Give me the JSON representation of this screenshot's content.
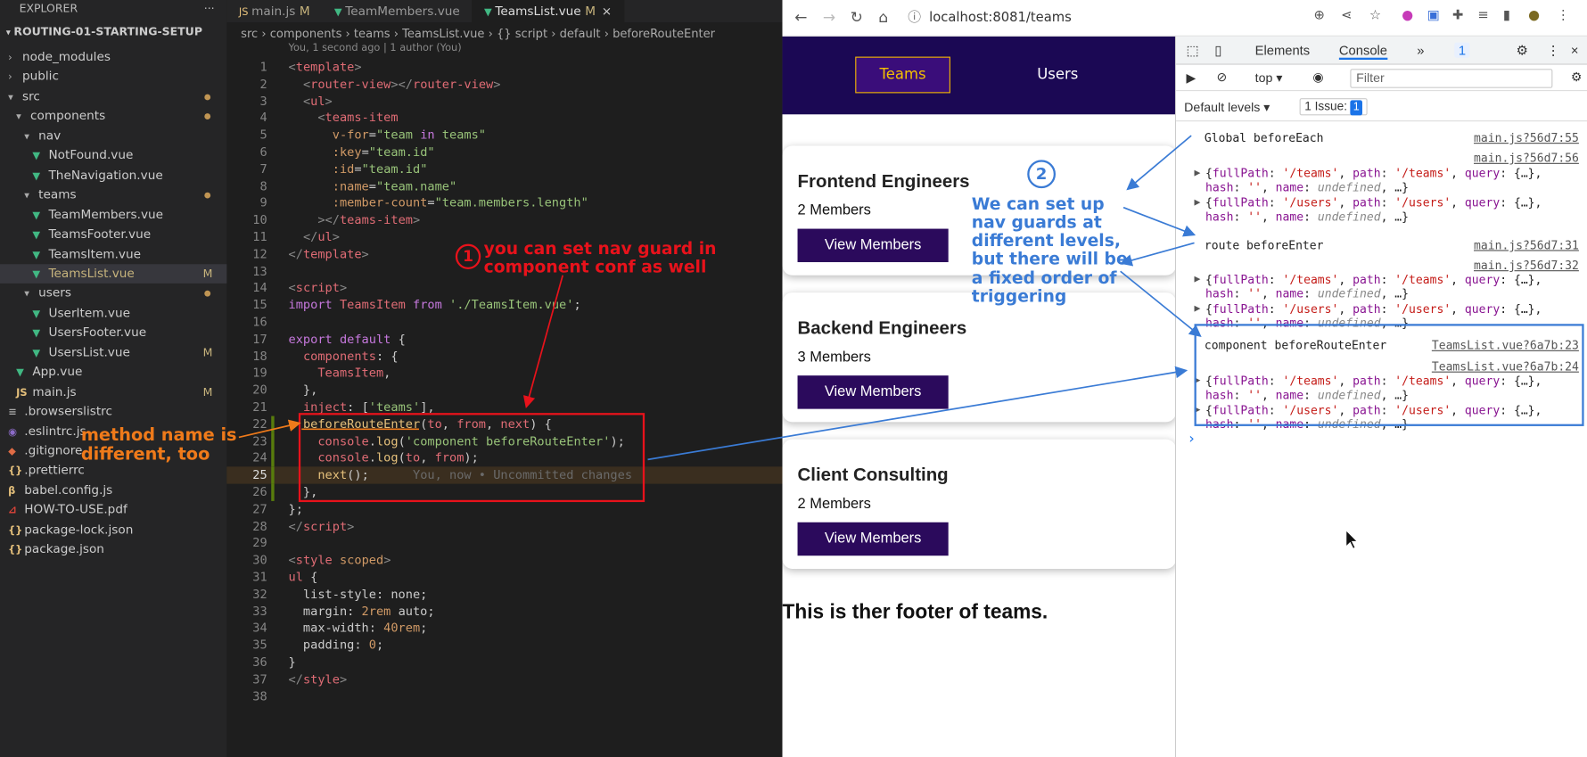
{
  "explorer": {
    "title": "EXPLORER",
    "more": "···",
    "project": "ROUTING-01-STARTING-SETUP",
    "items": [
      {
        "label": "node_modules",
        "kind": "folder",
        "open": false,
        "depth": 1,
        "icon": "chevron-right-icon"
      },
      {
        "label": "public",
        "kind": "folder",
        "open": false,
        "depth": 1,
        "icon": "chevron-right-icon"
      },
      {
        "label": "src",
        "kind": "folder",
        "open": true,
        "depth": 1,
        "dot": true,
        "icon": "chevron-down-icon"
      },
      {
        "label": "components",
        "kind": "folder",
        "open": true,
        "depth": 2,
        "dot": true,
        "icon": "chevron-down-icon"
      },
      {
        "label": "nav",
        "kind": "folder",
        "open": true,
        "depth": 3,
        "icon": "chevron-down-icon"
      },
      {
        "label": "NotFound.vue",
        "kind": "vue",
        "depth": 4,
        "icon": "vue-icon"
      },
      {
        "label": "TheNavigation.vue",
        "kind": "vue",
        "depth": 4,
        "icon": "vue-icon"
      },
      {
        "label": "teams",
        "kind": "folder",
        "open": true,
        "depth": 3,
        "dot": true,
        "icon": "chevron-down-icon"
      },
      {
        "label": "TeamMembers.vue",
        "kind": "vue",
        "depth": 4,
        "icon": "vue-icon"
      },
      {
        "label": "TeamsFooter.vue",
        "kind": "vue",
        "depth": 4,
        "icon": "vue-icon"
      },
      {
        "label": "TeamsItem.vue",
        "kind": "vue",
        "depth": 4,
        "icon": "vue-icon"
      },
      {
        "label": "TeamsList.vue",
        "kind": "vue",
        "depth": 4,
        "selected": true,
        "badge": "M",
        "icon": "vue-icon"
      },
      {
        "label": "users",
        "kind": "folder",
        "open": true,
        "depth": 3,
        "dot": true,
        "icon": "chevron-down-icon"
      },
      {
        "label": "UserItem.vue",
        "kind": "vue",
        "depth": 4,
        "icon": "vue-icon"
      },
      {
        "label": "UsersFooter.vue",
        "kind": "vue",
        "depth": 4,
        "icon": "vue-icon"
      },
      {
        "label": "UsersList.vue",
        "kind": "vue",
        "depth": 4,
        "badge": "M",
        "icon": "vue-icon"
      },
      {
        "label": "App.vue",
        "kind": "vue",
        "depth": 2,
        "icon": "vue-icon"
      },
      {
        "label": "main.js",
        "kind": "js",
        "depth": 2,
        "badge": "M",
        "icon": "js-icon"
      },
      {
        "label": ".browserslistrc",
        "kind": "config",
        "depth": 1,
        "icon": "list-icon"
      },
      {
        "label": ".eslintrc.js",
        "kind": "eslint",
        "depth": 1,
        "icon": "eslint-icon"
      },
      {
        "label": ".gitignore",
        "kind": "git",
        "depth": 1,
        "icon": "git-icon"
      },
      {
        "label": ".prettierrc",
        "kind": "json",
        "depth": 1,
        "icon": "braces-icon"
      },
      {
        "label": "babel.config.js",
        "kind": "babel",
        "depth": 1,
        "icon": "babel-icon"
      },
      {
        "label": "HOW-TO-USE.pdf",
        "kind": "pdf",
        "depth": 1,
        "icon": "pdf-icon"
      },
      {
        "label": "package-lock.json",
        "kind": "json",
        "depth": 1,
        "icon": "braces-icon"
      },
      {
        "label": "package.json",
        "kind": "json",
        "depth": 1,
        "icon": "braces-icon"
      }
    ]
  },
  "tabs": [
    {
      "label": "main.js",
      "icon": "js-icon",
      "mod": "M",
      "active": false
    },
    {
      "label": "TeamMembers.vue",
      "icon": "vue-icon",
      "mod": "",
      "active": false
    },
    {
      "label": "TeamsList.vue",
      "icon": "vue-icon",
      "mod": "M",
      "active": true,
      "close": "×"
    }
  ],
  "breadcrumb": "src › components › teams › TeamsList.vue › {} script › default › beforeRouteEnter",
  "blame": "You, 1 second ago | 1 author (You)",
  "code": [
    {
      "n": "1",
      "toks": [
        [
          "t-br",
          "<"
        ],
        [
          "t-tag",
          "template"
        ],
        [
          "t-br",
          ">"
        ]
      ]
    },
    {
      "n": "2",
      "toks": [
        [
          "t-pl",
          "  "
        ],
        [
          "t-br",
          "<"
        ],
        [
          "t-tag",
          "router-view"
        ],
        [
          "t-br",
          "></"
        ],
        [
          "t-tag",
          "router-view"
        ],
        [
          "t-br",
          ">"
        ]
      ]
    },
    {
      "n": "3",
      "toks": [
        [
          "t-pl",
          "  "
        ],
        [
          "t-br",
          "<"
        ],
        [
          "t-tag",
          "ul"
        ],
        [
          "t-br",
          ">"
        ]
      ]
    },
    {
      "n": "4",
      "toks": [
        [
          "t-pl",
          "    "
        ],
        [
          "t-br",
          "<"
        ],
        [
          "t-tag",
          "teams-item"
        ]
      ]
    },
    {
      "n": "5",
      "toks": [
        [
          "t-pl",
          "      "
        ],
        [
          "t-at",
          "v-for"
        ],
        [
          "t-pl",
          "="
        ],
        [
          "t-str",
          "\"team "
        ],
        [
          "t-kw",
          "in"
        ],
        [
          "t-str",
          " teams\""
        ]
      ]
    },
    {
      "n": "6",
      "toks": [
        [
          "t-pl",
          "      "
        ],
        [
          "t-at",
          ":key"
        ],
        [
          "t-pl",
          "="
        ],
        [
          "t-str",
          "\"team.id\""
        ]
      ]
    },
    {
      "n": "7",
      "toks": [
        [
          "t-pl",
          "      "
        ],
        [
          "t-at",
          ":id"
        ],
        [
          "t-pl",
          "="
        ],
        [
          "t-str",
          "\"team.id\""
        ]
      ]
    },
    {
      "n": "8",
      "toks": [
        [
          "t-pl",
          "      "
        ],
        [
          "t-at",
          ":name"
        ],
        [
          "t-pl",
          "="
        ],
        [
          "t-str",
          "\"team.name\""
        ]
      ]
    },
    {
      "n": "9",
      "toks": [
        [
          "t-pl",
          "      "
        ],
        [
          "t-at",
          ":member-count"
        ],
        [
          "t-pl",
          "="
        ],
        [
          "t-str",
          "\"team.members.length\""
        ]
      ]
    },
    {
      "n": "10",
      "toks": [
        [
          "t-pl",
          "    "
        ],
        [
          "t-br",
          "></"
        ],
        [
          "t-tag",
          "teams-item"
        ],
        [
          "t-br",
          ">"
        ]
      ]
    },
    {
      "n": "11",
      "toks": [
        [
          "t-pl",
          "  "
        ],
        [
          "t-br",
          "</"
        ],
        [
          "t-tag",
          "ul"
        ],
        [
          "t-br",
          ">"
        ]
      ]
    },
    {
      "n": "12",
      "toks": [
        [
          "t-br",
          "</"
        ],
        [
          "t-tag",
          "template"
        ],
        [
          "t-br",
          ">"
        ]
      ]
    },
    {
      "n": "13",
      "toks": []
    },
    {
      "n": "14",
      "toks": [
        [
          "t-br",
          "<"
        ],
        [
          "t-tag",
          "script"
        ],
        [
          "t-br",
          ">"
        ]
      ]
    },
    {
      "n": "15",
      "toks": [
        [
          "t-kw",
          "import"
        ],
        [
          "t-pl",
          " "
        ],
        [
          "t-var",
          "TeamsItem"
        ],
        [
          "t-pl",
          " "
        ],
        [
          "t-kw",
          "from"
        ],
        [
          "t-pl",
          " "
        ],
        [
          "t-str",
          "'./TeamsItem.vue'"
        ],
        [
          "t-pl",
          ";"
        ]
      ]
    },
    {
      "n": "16",
      "toks": []
    },
    {
      "n": "17",
      "toks": [
        [
          "t-kw",
          "export default"
        ],
        [
          "t-pl",
          " {"
        ]
      ]
    },
    {
      "n": "18",
      "toks": [
        [
          "t-pl",
          "  "
        ],
        [
          "t-var",
          "components"
        ],
        [
          "t-pl",
          ": {"
        ]
      ]
    },
    {
      "n": "19",
      "toks": [
        [
          "t-pl",
          "    "
        ],
        [
          "t-var",
          "TeamsItem"
        ],
        [
          "t-pl",
          ","
        ]
      ]
    },
    {
      "n": "20",
      "toks": [
        [
          "t-pl",
          "  },"
        ]
      ]
    },
    {
      "n": "21",
      "toks": [
        [
          "t-pl",
          "  "
        ],
        [
          "t-var",
          "inject"
        ],
        [
          "t-pl",
          ": ["
        ],
        [
          "t-str",
          "'teams'"
        ],
        [
          "t-pl",
          "],"
        ]
      ]
    },
    {
      "n": "22",
      "toks": [
        [
          "t-pl",
          "  "
        ],
        [
          "t-fn",
          "beforeRouteEnter"
        ],
        [
          "t-pl",
          "("
        ],
        [
          "t-var",
          "to"
        ],
        [
          "t-pl",
          ", "
        ],
        [
          "t-var",
          "from"
        ],
        [
          "t-pl",
          ", "
        ],
        [
          "t-var",
          "next"
        ],
        [
          "t-pl",
          ") {"
        ]
      ]
    },
    {
      "n": "23",
      "toks": [
        [
          "t-pl",
          "    "
        ],
        [
          "t-var",
          "console"
        ],
        [
          "t-pl",
          "."
        ],
        [
          "t-fn",
          "log"
        ],
        [
          "t-pl",
          "("
        ],
        [
          "t-str",
          "'component beforeRouteEnter'"
        ],
        [
          "t-pl",
          ");"
        ]
      ]
    },
    {
      "n": "24",
      "toks": [
        [
          "t-pl",
          "    "
        ],
        [
          "t-var",
          "console"
        ],
        [
          "t-pl",
          "."
        ],
        [
          "t-fn",
          "log"
        ],
        [
          "t-pl",
          "("
        ],
        [
          "t-var",
          "to"
        ],
        [
          "t-pl",
          ", "
        ],
        [
          "t-var",
          "from"
        ],
        [
          "t-pl",
          ");"
        ]
      ]
    },
    {
      "n": "25",
      "toks": [
        [
          "t-pl",
          "    "
        ],
        [
          "t-fn",
          "next"
        ],
        [
          "t-pl",
          "();"
        ],
        [
          "t-ghost",
          "      You, now • Uncommitted changes"
        ]
      ],
      "hl": true
    },
    {
      "n": "26",
      "toks": [
        [
          "t-pl",
          "  },"
        ]
      ]
    },
    {
      "n": "27",
      "toks": [
        [
          "t-pl",
          "};"
        ]
      ]
    },
    {
      "n": "28",
      "toks": [
        [
          "t-br",
          "</"
        ],
        [
          "t-tag",
          "script"
        ],
        [
          "t-br",
          ">"
        ]
      ]
    },
    {
      "n": "29",
      "toks": []
    },
    {
      "n": "30",
      "toks": [
        [
          "t-br",
          "<"
        ],
        [
          "t-tag",
          "style"
        ],
        [
          "t-pl",
          " "
        ],
        [
          "t-at",
          "scoped"
        ],
        [
          "t-br",
          ">"
        ]
      ]
    },
    {
      "n": "31",
      "toks": [
        [
          "t-tag",
          "ul"
        ],
        [
          "t-pl",
          " {"
        ]
      ]
    },
    {
      "n": "32",
      "toks": [
        [
          "t-pl",
          "  "
        ],
        [
          "t-pl",
          "list-style: none;"
        ]
      ]
    },
    {
      "n": "33",
      "toks": [
        [
          "t-pl",
          "  margin: "
        ],
        [
          "t-num",
          "2rem"
        ],
        [
          "t-pl",
          " auto;"
        ]
      ]
    },
    {
      "n": "34",
      "toks": [
        [
          "t-pl",
          "  max-width: "
        ],
        [
          "t-num",
          "40rem"
        ],
        [
          "t-pl",
          ";"
        ]
      ]
    },
    {
      "n": "35",
      "toks": [
        [
          "t-pl",
          "  padding: "
        ],
        [
          "t-num",
          "0"
        ],
        [
          "t-pl",
          ";"
        ]
      ]
    },
    {
      "n": "36",
      "toks": [
        [
          "t-pl",
          "}"
        ]
      ]
    },
    {
      "n": "37",
      "toks": [
        [
          "t-br",
          "</"
        ],
        [
          "t-tag",
          "style"
        ],
        [
          "t-br",
          ">"
        ]
      ]
    },
    {
      "n": "38",
      "toks": []
    }
  ],
  "browser": {
    "url": "localhost:8081/teams",
    "nav": {
      "teams": "Teams",
      "users": "Users"
    },
    "cards": [
      {
        "name": "Frontend Engineers",
        "members": "2 Members",
        "button": "View Members"
      },
      {
        "name": "Backend Engineers",
        "members": "3 Members",
        "button": "View Members"
      },
      {
        "name": "Client Consulting",
        "members": "2 Members",
        "button": "View Members"
      }
    ],
    "footer": "This is ther footer of teams."
  },
  "devtools": {
    "tabs": {
      "elements": "Elements",
      "console": "Console",
      "more": "»",
      "issues_count": "1"
    },
    "context": "top",
    "filter_placeholder": "Filter",
    "levels": "Default levels ▾",
    "issue_label": "1 Issue:",
    "issue_count": "1",
    "logs": [
      {
        "text": "Global beforeEach",
        "src": "main.js?56d7:55"
      },
      {
        "text": "",
        "src": "main.js?56d7:56"
      },
      {
        "text": "route beforeEnter",
        "src": "main.js?56d7:31"
      },
      {
        "text": "",
        "src": "main.js?56d7:32"
      },
      {
        "text": "component beforeRouteEnter",
        "src": "TeamsList.vue?6a7b:23"
      },
      {
        "text": "",
        "src": "TeamsList.vue?6a7b:24"
      }
    ],
    "obj_teams": {
      "a": "{",
      "k1": "fullPath",
      "s1": "'/teams'",
      "k2": "path",
      "s2": "'/teams'",
      "k3": "query",
      "q": "{…},"
    },
    "obj_users": {
      "a": "{",
      "k1": "fullPath",
      "s1": "'/users'",
      "k2": "path",
      "s2": "'/users'",
      "k3": "query",
      "q": "{…},"
    },
    "obj_tail": {
      "k4": "hash",
      "s4": "''",
      "k5": "name",
      "u5": "undefined",
      "end": ", …}"
    },
    "prompt": "›"
  },
  "annotations": {
    "n1": "1",
    "note1": "you can set nav guard in component conf as well",
    "note2": "method name is different, too",
    "n2": "2",
    "note3": "We can set up nav guards at different levels, but there will be a fixed order of triggering"
  },
  "colors": {
    "red": "#e8121b",
    "orange": "#ef7a1a",
    "blue": "#3a7bd5",
    "navbar": "#1b0854",
    "button": "#2b0a5c"
  }
}
